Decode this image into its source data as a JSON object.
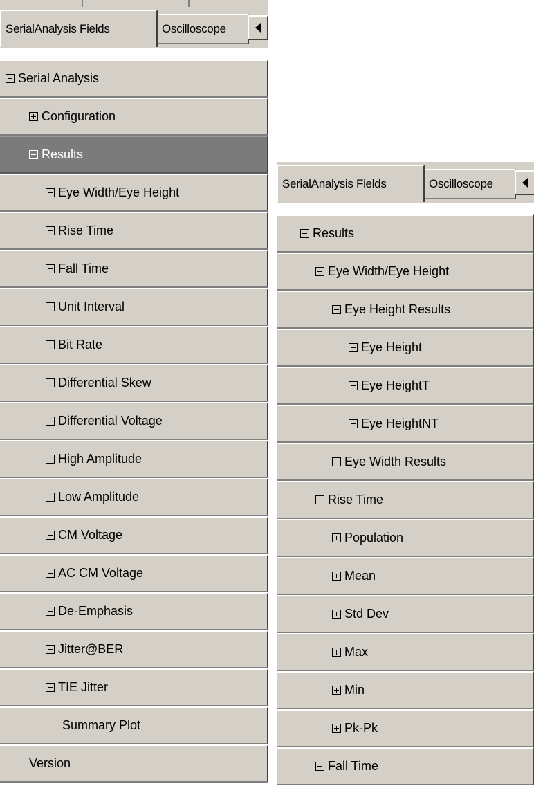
{
  "left": {
    "tabs": [
      {
        "label": "SerialAnalysis Fields",
        "active": true
      },
      {
        "label": "Oscilloscope",
        "active": false
      }
    ],
    "scroll_icon": "triangle-left",
    "items": [
      {
        "label": "Serial Analysis",
        "state": "collapse",
        "level": 0,
        "selected": false
      },
      {
        "label": "Configuration",
        "state": "expand",
        "level": 1,
        "selected": false
      },
      {
        "label": "Results",
        "state": "collapse",
        "level": 1,
        "selected": true
      },
      {
        "label": "Eye Width/Eye Height",
        "state": "expand",
        "level": 2,
        "selected": false
      },
      {
        "label": "Rise Time",
        "state": "expand",
        "level": 2,
        "selected": false
      },
      {
        "label": "Fall Time",
        "state": "expand",
        "level": 2,
        "selected": false
      },
      {
        "label": "Unit Interval",
        "state": "expand",
        "level": 2,
        "selected": false
      },
      {
        "label": "Bit Rate",
        "state": "expand",
        "level": 2,
        "selected": false
      },
      {
        "label": "Differential Skew",
        "state": "expand",
        "level": 2,
        "selected": false
      },
      {
        "label": "Differential Voltage",
        "state": "expand",
        "level": 2,
        "selected": false
      },
      {
        "label": "High Amplitude",
        "state": "expand",
        "level": 2,
        "selected": false
      },
      {
        "label": "Low Amplitude",
        "state": "expand",
        "level": 2,
        "selected": false
      },
      {
        "label": "CM Voltage",
        "state": "expand",
        "level": 2,
        "selected": false
      },
      {
        "label": "AC CM Voltage",
        "state": "expand",
        "level": 2,
        "selected": false
      },
      {
        "label": "De-Emphasis",
        "state": "expand",
        "level": 2,
        "selected": false
      },
      {
        "label": "Jitter@BER",
        "state": "expand",
        "level": 2,
        "selected": false
      },
      {
        "label": "TIE Jitter",
        "state": "expand",
        "level": 2,
        "selected": false
      },
      {
        "label": "Summary Plot",
        "state": "none",
        "level": 2,
        "selected": false
      },
      {
        "label": "Version",
        "state": "none",
        "level": 1,
        "selected": false
      }
    ]
  },
  "right": {
    "tabs": [
      {
        "label": "SerialAnalysis Fields",
        "active": true
      },
      {
        "label": "Oscilloscope",
        "active": false
      }
    ],
    "scroll_icon": "triangle-left",
    "items": [
      {
        "label": "Results",
        "state": "collapse",
        "level": 1
      },
      {
        "label": "Eye Width/Eye Height",
        "state": "collapse",
        "level": 2
      },
      {
        "label": "Eye Height Results",
        "state": "collapse",
        "level": 3
      },
      {
        "label": "Eye Height",
        "state": "expand",
        "level": 4
      },
      {
        "label": "Eye HeightT",
        "state": "expand",
        "level": 4
      },
      {
        "label": "Eye HeightNT",
        "state": "expand",
        "level": 4
      },
      {
        "label": "Eye Width Results",
        "state": "collapse",
        "level": 3
      },
      {
        "label": "Rise Time",
        "state": "collapse",
        "level": 2
      },
      {
        "label": "Population",
        "state": "expand",
        "level": 3
      },
      {
        "label": "Mean",
        "state": "expand",
        "level": 3
      },
      {
        "label": "Std Dev",
        "state": "expand",
        "level": 3
      },
      {
        "label": "Max",
        "state": "expand",
        "level": 3
      },
      {
        "label": "Min",
        "state": "expand",
        "level": 3
      },
      {
        "label": "Pk-Pk",
        "state": "expand",
        "level": 3
      },
      {
        "label": "Fall Time",
        "state": "collapse",
        "level": 2
      }
    ]
  }
}
